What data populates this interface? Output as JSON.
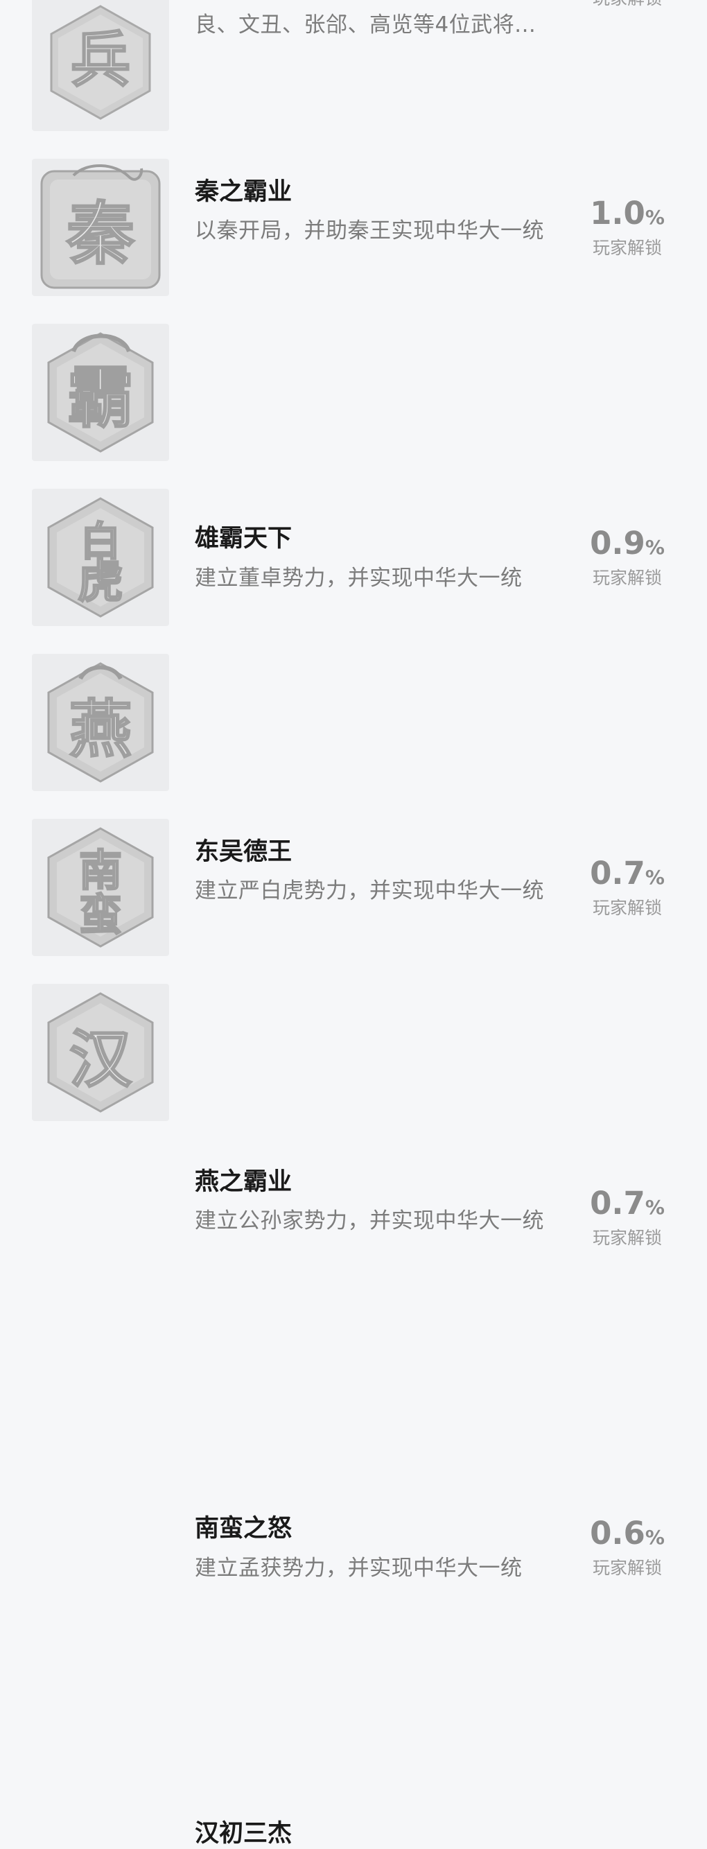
{
  "unlock_label": "玩家解锁",
  "percent_unit": "%",
  "achievements": [
    {
      "title": "",
      "desc": "良、文丑、张郃、高览等4位武将...",
      "percent": "",
      "seal": [
        "兵"
      ]
    },
    {
      "title": "秦之霸业",
      "desc": "以秦开局，并助秦王实现中华大一统",
      "percent": "1.0",
      "seal": [
        "秦"
      ]
    },
    {
      "title": "雄霸天下",
      "desc": "建立董卓势力，并实现中华大一统",
      "percent": "0.9",
      "seal": [
        "霸"
      ]
    },
    {
      "title": "东吴德王",
      "desc": "建立严白虎势力，并实现中华大一统",
      "percent": "0.7",
      "seal": [
        "白",
        "虎"
      ]
    },
    {
      "title": "燕之霸业",
      "desc": "建立公孙家势力，并实现中华大一统",
      "percent": "0.7",
      "seal": [
        "燕"
      ]
    },
    {
      "title": "南蛮之怒",
      "desc": "建立孟获势力，并实现中华大一统",
      "percent": "0.6",
      "seal": [
        "南",
        "蛮"
      ]
    },
    {
      "title": "汉初三杰",
      "desc": "",
      "percent": "",
      "seal": [
        "汉"
      ]
    }
  ]
}
